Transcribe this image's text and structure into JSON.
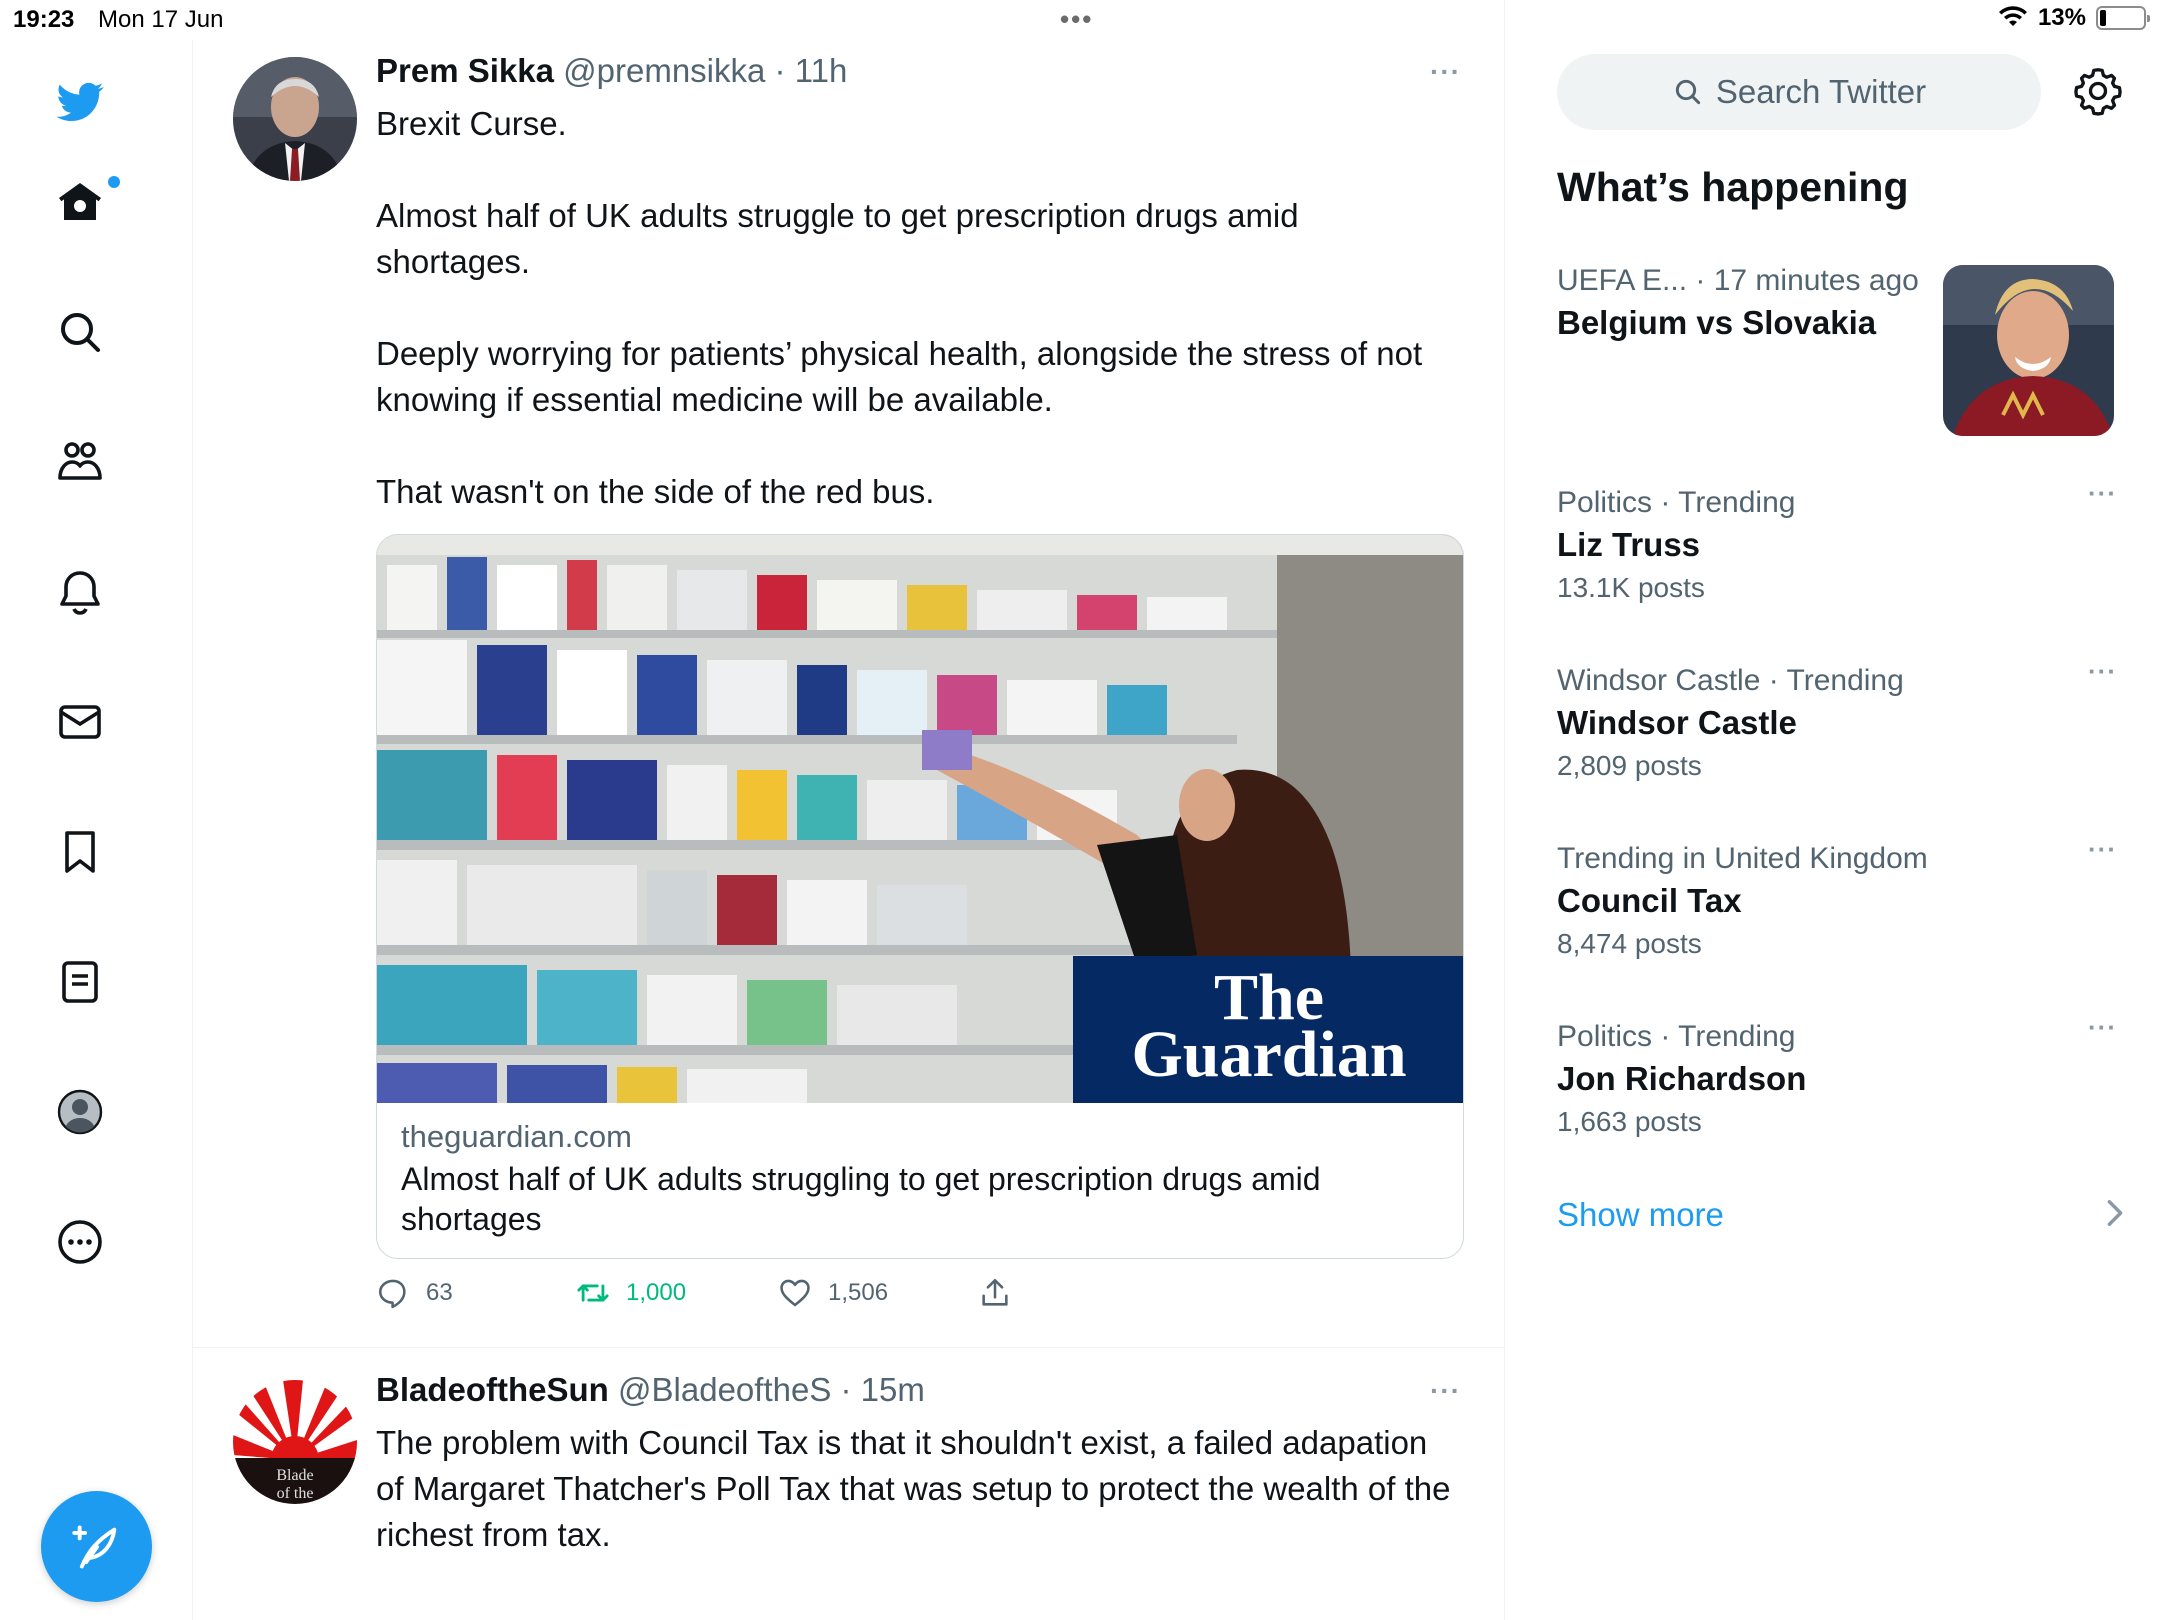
{
  "status_bar": {
    "time": "19:23",
    "date": "Mon 17 Jun",
    "battery": "13%",
    "battery_level": 0.13
  },
  "nav": {
    "items": [
      {
        "name": "twitter-logo",
        "icon": "bird-icon"
      },
      {
        "name": "home",
        "icon": "home-icon"
      },
      {
        "name": "explore",
        "icon": "search-icon"
      },
      {
        "name": "communities",
        "icon": "people-icon"
      },
      {
        "name": "notifications",
        "icon": "bell-icon"
      },
      {
        "name": "messages",
        "icon": "mail-icon"
      },
      {
        "name": "bookmarks",
        "icon": "bookmark-icon"
      },
      {
        "name": "lists",
        "icon": "list-icon"
      },
      {
        "name": "profile",
        "icon": "avatar-icon"
      },
      {
        "name": "more",
        "icon": "more-circle-icon"
      }
    ],
    "compose_icon": "feather-plus-icon"
  },
  "tweets": [
    {
      "name": "Prem Sikka",
      "handle": "@premnsikka",
      "time": "11h",
      "paragraphs": [
        "Brexit Curse.",
        "Almost half of UK adults struggle to get prescription drugs amid shortages.",
        "Deeply worrying for patients’ physical health, alongside the stress of not knowing if essential medicine will be available.",
        "That wasn't on the side of the red bus."
      ],
      "card": {
        "logo_line1": "The",
        "logo_line2": "Guardian",
        "domain": "theguardian.com",
        "title": "Almost half of UK adults struggling to get prescription drugs amid shortages"
      },
      "actions": {
        "replies": "63",
        "retweets": "1,000",
        "likes": "1,506"
      }
    },
    {
      "name": "BladeoftheSun",
      "handle": "@BladeoftheS",
      "time": "15m",
      "avatar_text_1": "Blade",
      "avatar_text_2": "of the",
      "text": "The problem with Council Tax is that it shouldn't exist, a failed adapation of Margaret Thatcher's Poll Tax that was setup to protect the wealth of the richest from tax."
    }
  ],
  "sidebar": {
    "search_placeholder": "Search Twitter",
    "heading": "What’s happening",
    "trends": [
      {
        "context": "UEFA E...",
        "time": "· 17 minutes ago",
        "title": "Belgium vs Slovakia",
        "posts": ""
      },
      {
        "context": "Politics · Trending",
        "title": "Liz Truss",
        "posts": "13.1K posts"
      },
      {
        "context": "Windsor Castle · Trending",
        "title": "Windsor Castle",
        "posts": "2,809 posts"
      },
      {
        "context": "Trending in United Kingdom",
        "title": "Council Tax",
        "posts": "8,474 posts"
      },
      {
        "context": "Politics · Trending",
        "title": "Jon Richardson",
        "posts": "1,663 posts"
      }
    ],
    "show_more": "Show more"
  },
  "colors": {
    "accent": "#1d9bf0",
    "retweet": "#00ba7c",
    "secondary_text": "#536471",
    "guardian_blue": "#052962"
  }
}
